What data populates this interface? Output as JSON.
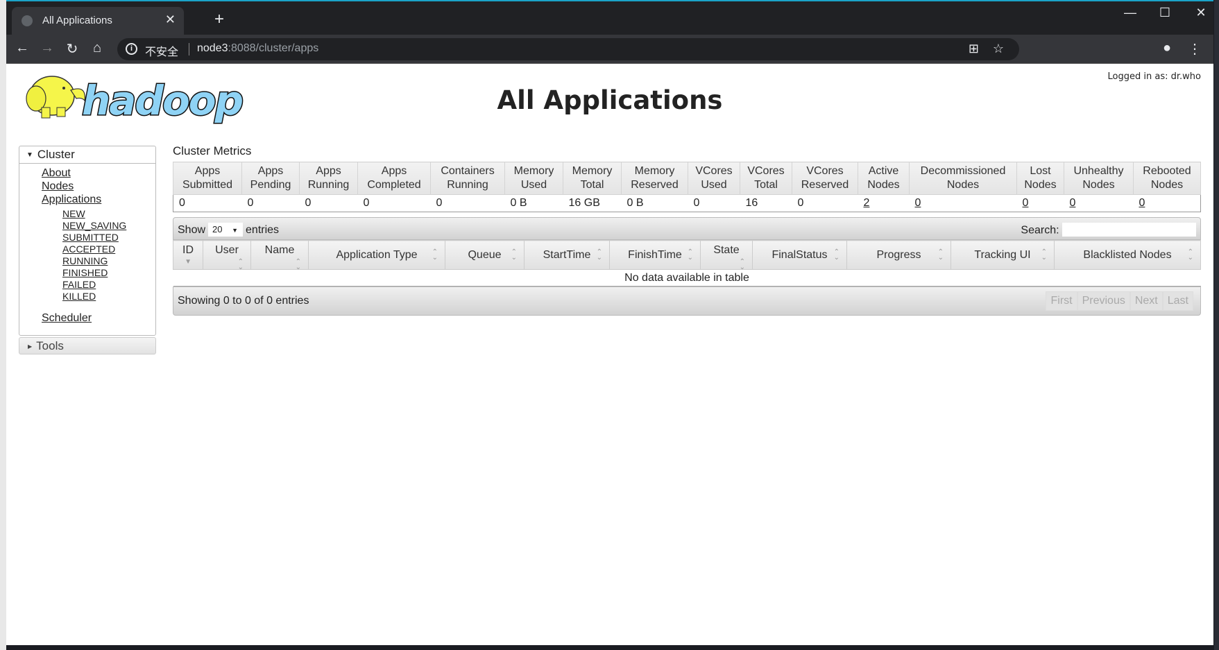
{
  "browser": {
    "tab_title": "All Applications",
    "not_secure": "不安全",
    "url_host": "node3",
    "url_path": ":8088/cluster/apps"
  },
  "header": {
    "title": "All Applications",
    "logged_in": "Logged in as: dr.who",
    "logo_text": "hadoop"
  },
  "sidebar": {
    "cluster": "Cluster",
    "links": [
      "About",
      "Nodes",
      "Applications"
    ],
    "app_states": [
      "NEW",
      "NEW_SAVING",
      "SUBMITTED",
      "ACCEPTED",
      "RUNNING",
      "FINISHED",
      "FAILED",
      "KILLED"
    ],
    "scheduler": "Scheduler",
    "tools": "Tools"
  },
  "metrics": {
    "heading": "Cluster Metrics",
    "headers": [
      [
        "Apps",
        "Submitted"
      ],
      [
        "Apps",
        "Pending"
      ],
      [
        "Apps",
        "Running"
      ],
      [
        "Apps",
        "Completed"
      ],
      [
        "Containers",
        "Running"
      ],
      [
        "Memory",
        "Used"
      ],
      [
        "Memory",
        "Total"
      ],
      [
        "Memory",
        "Reserved"
      ],
      [
        "VCores",
        "Used"
      ],
      [
        "VCores",
        "Total"
      ],
      [
        "VCores",
        "Reserved"
      ],
      [
        "Active",
        "Nodes"
      ],
      [
        "Decommissioned",
        "Nodes"
      ],
      [
        "Lost",
        "Nodes"
      ],
      [
        "Unhealthy",
        "Nodes"
      ],
      [
        "Rebooted",
        "Nodes"
      ]
    ],
    "values": [
      "0",
      "0",
      "0",
      "0",
      "0",
      "0 B",
      "16 GB",
      "0 B",
      "0",
      "16",
      "0",
      "2",
      "0",
      "0",
      "0",
      "0"
    ]
  },
  "apps": {
    "show": "Show",
    "entries_value": "20",
    "entries": "entries",
    "search": "Search:",
    "columns": [
      "ID",
      "User",
      "Name",
      "Application Type",
      "Queue",
      "StartTime",
      "FinishTime",
      "State",
      "FinalStatus",
      "Progress",
      "Tracking UI",
      "Blacklisted Nodes"
    ],
    "empty": "No data available in table",
    "info": "Showing 0 to 0 of 0 entries",
    "pager": [
      "First",
      "Previous",
      "Next",
      "Last"
    ]
  },
  "colors": {
    "logo_blue": "#8fd3f5",
    "logo_yellow": "#f5f54a"
  }
}
